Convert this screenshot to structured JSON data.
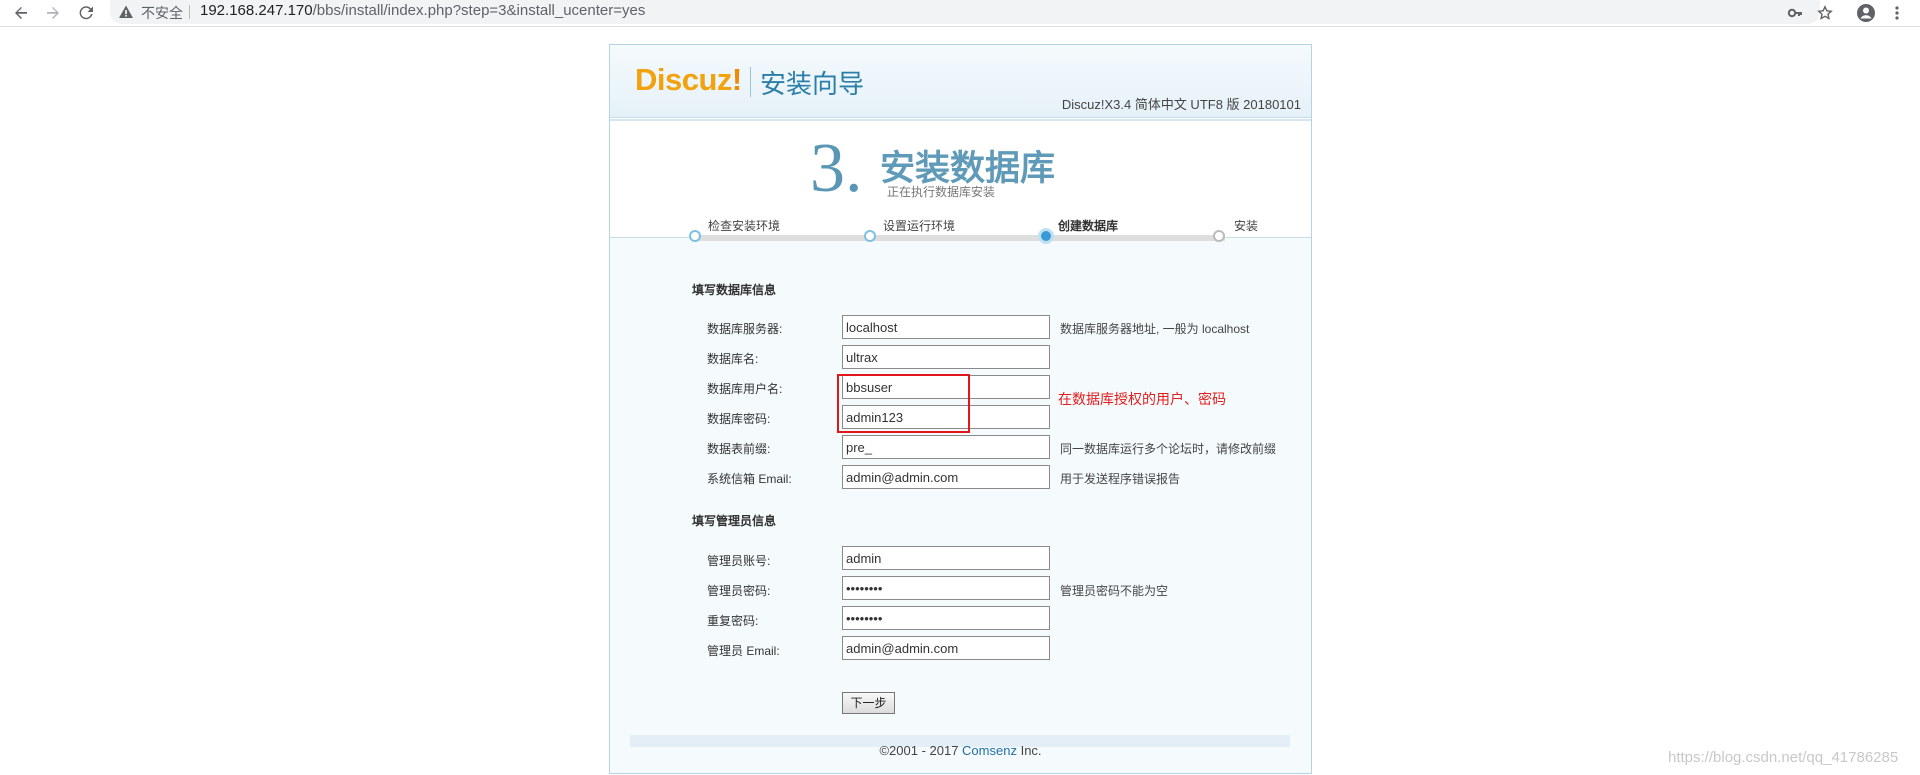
{
  "browser": {
    "insecure_label": "不安全",
    "url_host": "192.168.247.170",
    "url_path": "/bbs/install/index.php?step=3&install_ucenter=yes",
    "icons": [
      "back-arrow-icon",
      "forward-arrow-icon",
      "reload-icon",
      "warning-icon",
      "key-icon",
      "star-icon",
      "account-icon",
      "menu-icon"
    ]
  },
  "header": {
    "logo_text": "Discuz",
    "logo_excl": "!",
    "wizard_title": "安装向导",
    "version": "Discuz!X3.4 简体中文 UTF8 版 20180101"
  },
  "step": {
    "number": "3.",
    "title": "安装数据库",
    "subtitle": "正在执行数据库安装"
  },
  "progress": {
    "steps": [
      {
        "label": "检查安装环境",
        "state": "done"
      },
      {
        "label": "设置运行环境",
        "state": "done"
      },
      {
        "label": "创建数据库",
        "state": "current"
      },
      {
        "label": "安装",
        "state": "pending"
      }
    ]
  },
  "db": {
    "section_title": "填写数据库信息",
    "fields": [
      {
        "label": "数据库服务器:",
        "value": "localhost",
        "hint": "数据库服务器地址, 一般为 localhost"
      },
      {
        "label": "数据库名:",
        "value": "ultrax",
        "hint": ""
      },
      {
        "label": "数据库用户名:",
        "value": "bbsuser",
        "hint": ""
      },
      {
        "label": "数据库密码:",
        "value": "admin123",
        "hint": ""
      },
      {
        "label": "数据表前缀:",
        "value": "pre_",
        "hint": "同一数据库运行多个论坛时，请修改前缀"
      },
      {
        "label": "系统信箱 Email:",
        "value": "admin@admin.com",
        "hint": "用于发送程序错误报告"
      }
    ]
  },
  "admin": {
    "section_title": "填写管理员信息",
    "fields": [
      {
        "label": "管理员账号:",
        "value": "admin",
        "hint": ""
      },
      {
        "label": "管理员密码:",
        "value": "••••••••",
        "hint": "管理员密码不能为空"
      },
      {
        "label": "重复密码:",
        "value": "••••••••",
        "hint": ""
      },
      {
        "label": "管理员 Email:",
        "value": "admin@admin.com",
        "hint": ""
      }
    ]
  },
  "annotation": "在数据库授权的用户、密码",
  "next_button": "下一步",
  "footer": {
    "prefix": "©2001 - 2017 ",
    "brand": "Comsenz",
    "suffix": " Inc."
  },
  "watermark": "https://blog.csdn.net/qq_41786285",
  "colors": {
    "accent": "#2a7fa8",
    "logo": "#f2a20d",
    "annotation": "#e21d1d"
  }
}
